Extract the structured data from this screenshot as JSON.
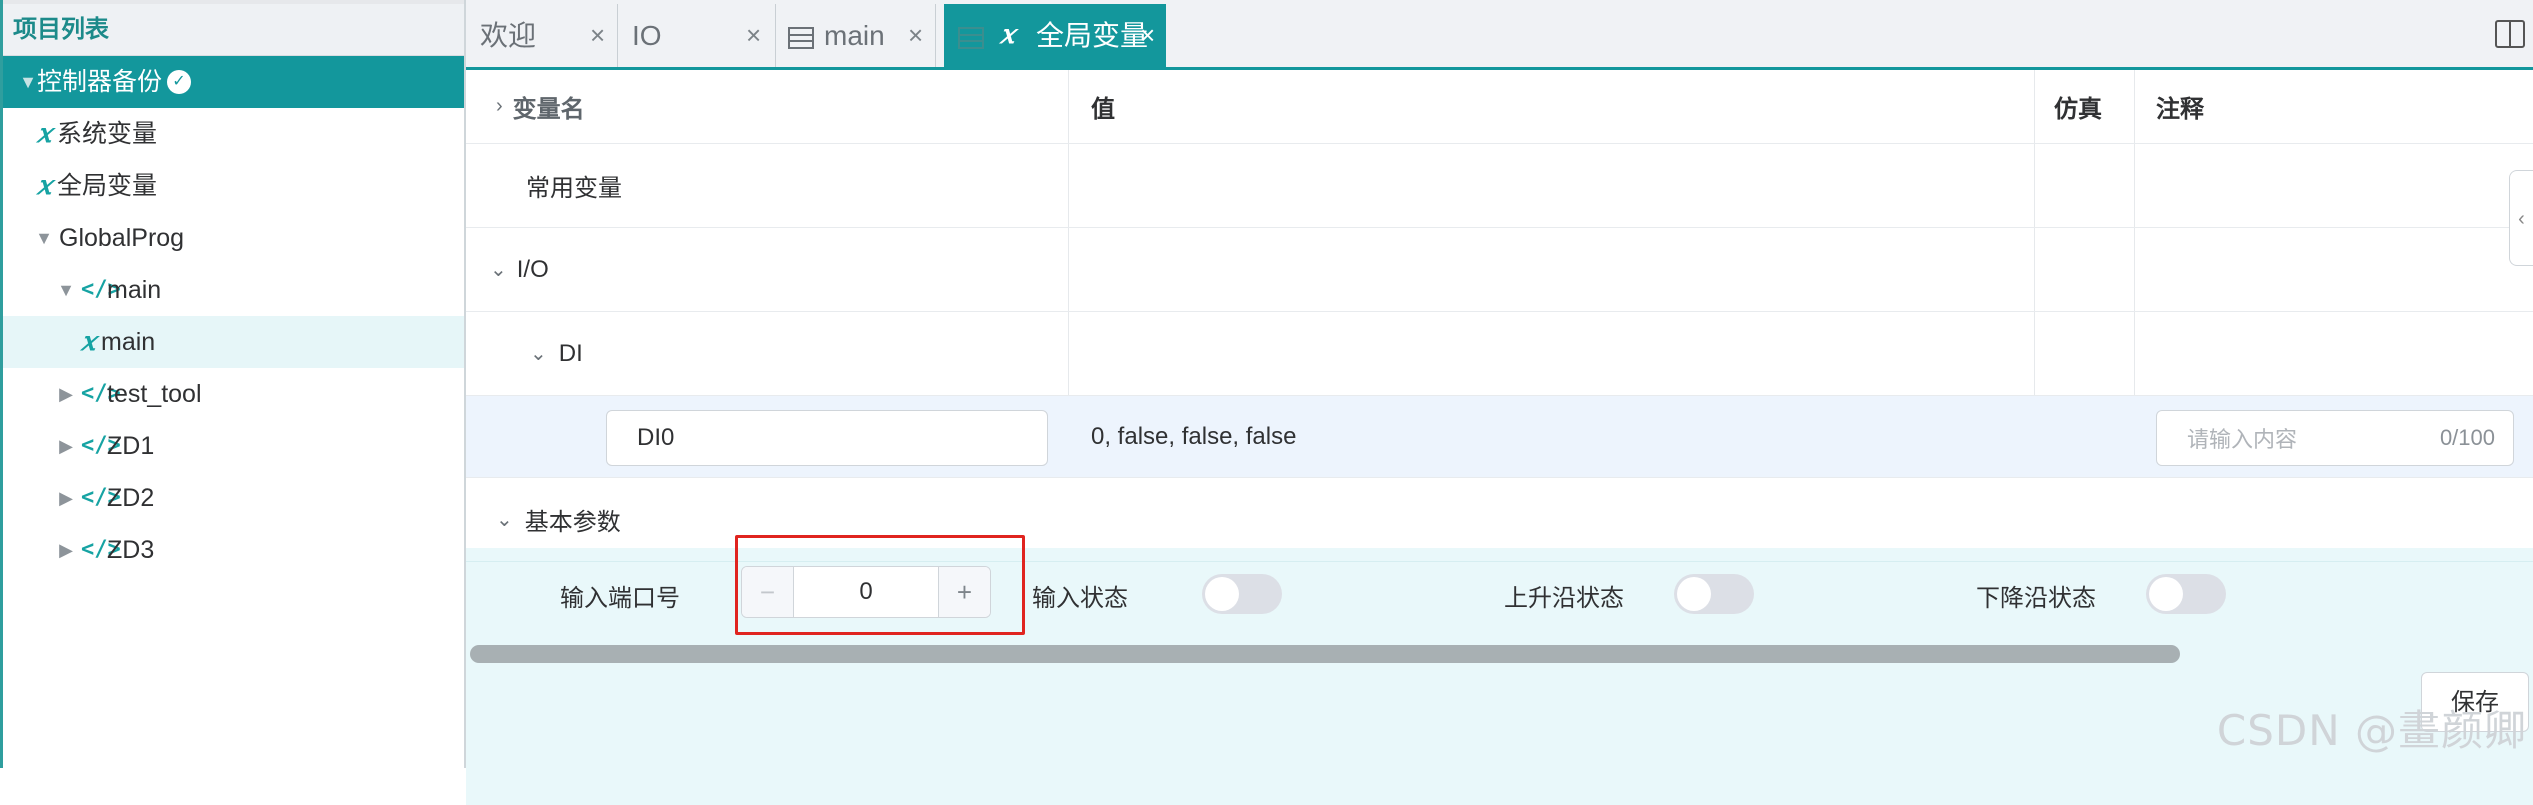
{
  "sidebar": {
    "title": "项目列表",
    "items": [
      {
        "label": "控制器备份",
        "icon": "check-circle-icon"
      },
      {
        "label": "系统变量",
        "icon": "variable-icon"
      },
      {
        "label": "全局变量",
        "icon": "variable-icon"
      },
      {
        "label": "GlobalProg"
      },
      {
        "label": "main",
        "icon": "code-icon"
      },
      {
        "label": "main",
        "icon": "variable-icon"
      },
      {
        "label": "test_tool",
        "icon": "code-icon"
      },
      {
        "label": "ZD1",
        "icon": "code-icon"
      },
      {
        "label": "ZD2",
        "icon": "code-icon"
      },
      {
        "label": "ZD3",
        "icon": "code-icon"
      }
    ]
  },
  "tabs": [
    {
      "label": "欢迎"
    },
    {
      "label": "IO"
    },
    {
      "label": "main",
      "icon": "table-icon"
    },
    {
      "label": "全局变量",
      "icon": "variable-icon",
      "active": true
    }
  ],
  "table": {
    "headers": {
      "name": "变量名",
      "value": "值",
      "sim": "仿真",
      "comment": "注释"
    },
    "rows": {
      "common": "常用变量",
      "io": "I/O",
      "di": "DI",
      "di0_name": "DI0",
      "di0_value": "0, false, false, false",
      "di0_comment_placeholder": "请输入内容",
      "di0_comment_counter": "0/100"
    }
  },
  "params": {
    "section_title": "基本参数",
    "port_label": "输入端口号",
    "port_value": "0",
    "minus": "−",
    "plus": "+",
    "input_state_label": "输入状态",
    "rising_label": "上升沿状态",
    "falling_label": "下降沿状态",
    "save_label": "保存"
  },
  "watermark": "CSDN @畫颜卿",
  "colors": {
    "accent": "#13979c",
    "highlight": "#e0241f"
  }
}
